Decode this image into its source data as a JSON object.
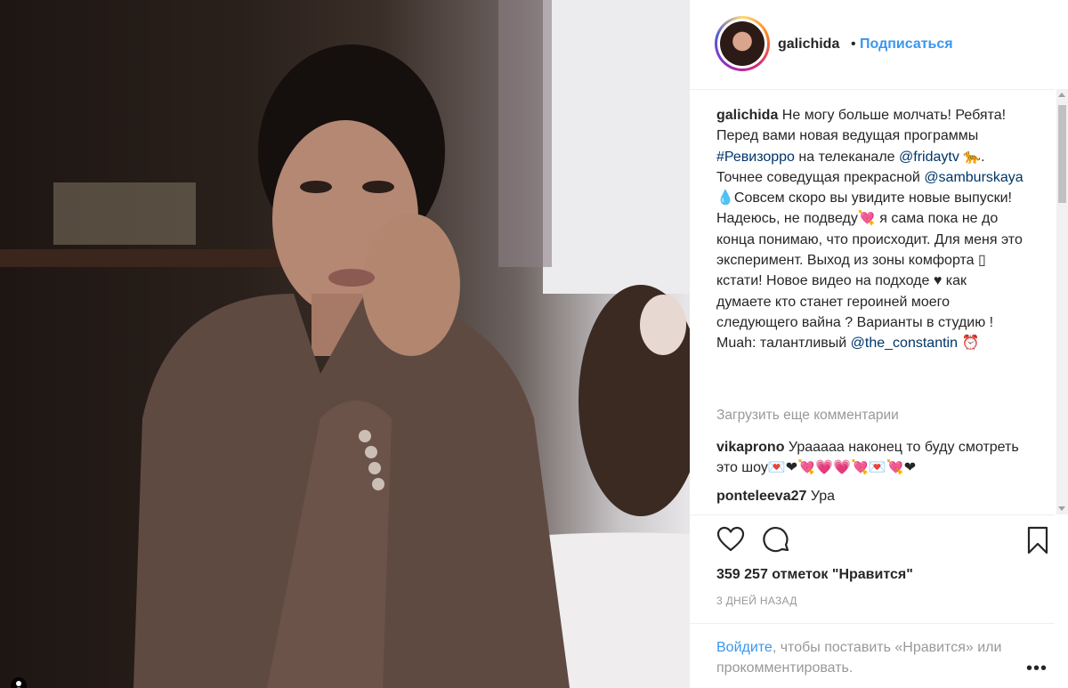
{
  "header": {
    "username": "galichida",
    "separator": "•",
    "follow_label": "Подписаться"
  },
  "caption": {
    "username": "galichida",
    "part1": " Не могу больше молчать! Ребята! Перед вами новая ведущая программы ",
    "hashtag": "#Ревизорро",
    "part2": " на телеканале ",
    "mention1": "@fridaytv",
    "part3": " 🐆. Точнее соведущая прекрасной ",
    "mention2": "@samburskaya",
    "part4": " 💧Совсем скоро вы увидите новые выпуски! Надеюсь, не подведу💘 я сама пока не до конца понимаю, что происходит. Для меня это эксперимент. Выход из зоны комфорта ▯ кстати! Новое видео на подходе ♥ как думаете кто станет героиней моего следующего вайна ? Варианты в студию ! Muah: талантливый ",
    "mention3": "@the_constantin",
    "part5": " ⏰"
  },
  "load_more": "Загрузить еще комментарии",
  "comments": [
    {
      "username": "vikaprono",
      "text": " Урааааа наконец то буду смотреть это шоу💌❤💘💗💗💘💌💘❤"
    },
    {
      "username": "ponteleeva27",
      "text": " Ура"
    }
  ],
  "likes": "359 257 отметок \"Нравится\"",
  "timestamp": "3 ДНЕЙ НАЗАД",
  "login_prompt": {
    "link": "Войдите",
    "text": ", чтобы поставить «Нравится» или прокомментировать."
  },
  "more_options": "•••",
  "icons": {
    "like": "heart-icon",
    "comment": "comment-icon",
    "save": "bookmark-icon",
    "tagged": "user-icon"
  },
  "colors": {
    "link_blue": "#3897f0",
    "mention": "#003569",
    "muted": "#999999"
  }
}
